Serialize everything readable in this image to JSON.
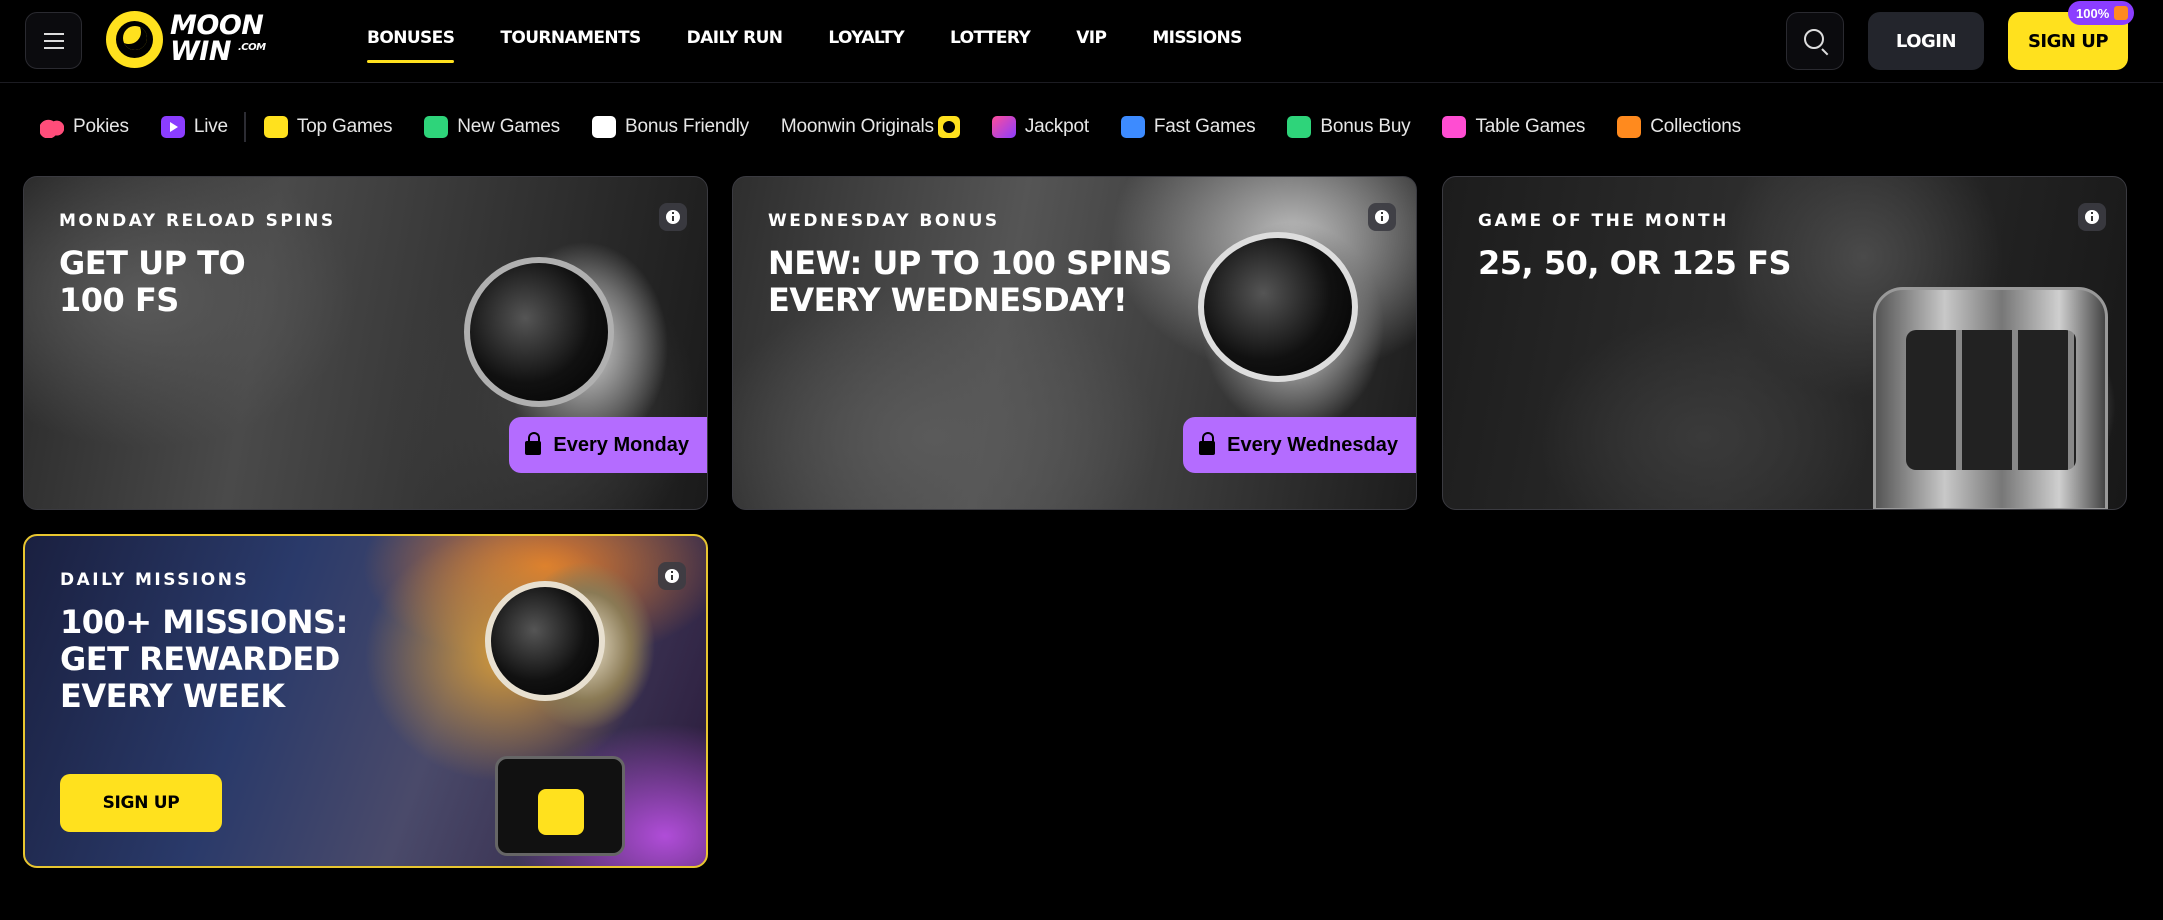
{
  "header": {
    "logo_text_line1": "MOON",
    "logo_text_line2": "WIN",
    "logo_text_com": ".COM",
    "nav": [
      {
        "label": "BONUSES",
        "active": true
      },
      {
        "label": "TOURNAMENTS"
      },
      {
        "label": "DAILY RUN"
      },
      {
        "label": "LOYALTY"
      },
      {
        "label": "LOTTERY"
      },
      {
        "label": "VIP"
      },
      {
        "label": "MISSIONS"
      }
    ],
    "login_label": "LOGIN",
    "signup_label": "SIGN UP",
    "signup_badge": "100%"
  },
  "categories": [
    {
      "label": "Pokies",
      "icon": "cherries-icon"
    },
    {
      "label": "Live",
      "icon": "live-play-icon"
    },
    {
      "label": "Top Games",
      "icon": "top-games-icon"
    },
    {
      "label": "New Games",
      "icon": "new-games-icon"
    },
    {
      "label": "Bonus Friendly",
      "icon": "bonus-friendly-icon"
    },
    {
      "label": "Moonwin Originals",
      "icon": "moonwin-logo-icon"
    },
    {
      "label": "Jackpot",
      "icon": "jackpot-icon"
    },
    {
      "label": "Fast Games",
      "icon": "rocket-icon"
    },
    {
      "label": "Bonus Buy",
      "icon": "coins-icon"
    },
    {
      "label": "Table Games",
      "icon": "chip-icon"
    },
    {
      "label": "Collections",
      "icon": "collections-icon"
    }
  ],
  "promos": [
    {
      "overline": "MONDAY RELOAD SPINS",
      "headline_1": "GET UP TO",
      "headline_2": "100 FS",
      "tag": "Every Monday"
    },
    {
      "overline": "WEDNESDAY BONUS",
      "headline_1": "NEW: UP TO 100 SPINS",
      "headline_2": "EVERY WEDNESDAY!",
      "tag": "Every Wednesday"
    },
    {
      "overline": "GAME OF THE MONTH",
      "headline_1": "25, 50, OR 125 FS"
    },
    {
      "overline": "DAILY MISSIONS",
      "headline_1": "100+ MISSIONS:",
      "headline_2": "GET REWARDED",
      "headline_3": "EVERY WEEK",
      "cta": "SIGN UP"
    }
  ],
  "colors": {
    "accent_yellow": "#ffe11e",
    "tag_purple": "#b46cff",
    "badge_purple": "#8b3dff",
    "login_bg": "#23252c"
  }
}
